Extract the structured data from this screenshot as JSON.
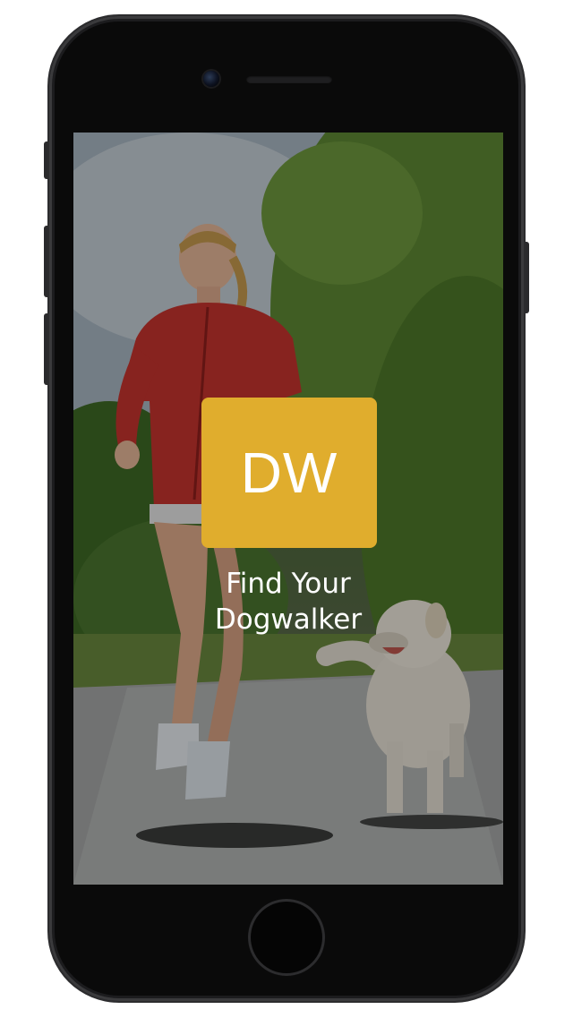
{
  "app": {
    "logo_text": "DW",
    "tagline_line1": "Find Your",
    "tagline_line2": "Dogwalker"
  },
  "colors": {
    "logo_background": "#e0ad2d",
    "text": "#ffffff",
    "phone_body": "#0a0a0a"
  },
  "icons": {
    "camera": "front-camera-icon",
    "speaker": "earpiece-speaker-icon",
    "home": "home-button-icon"
  }
}
